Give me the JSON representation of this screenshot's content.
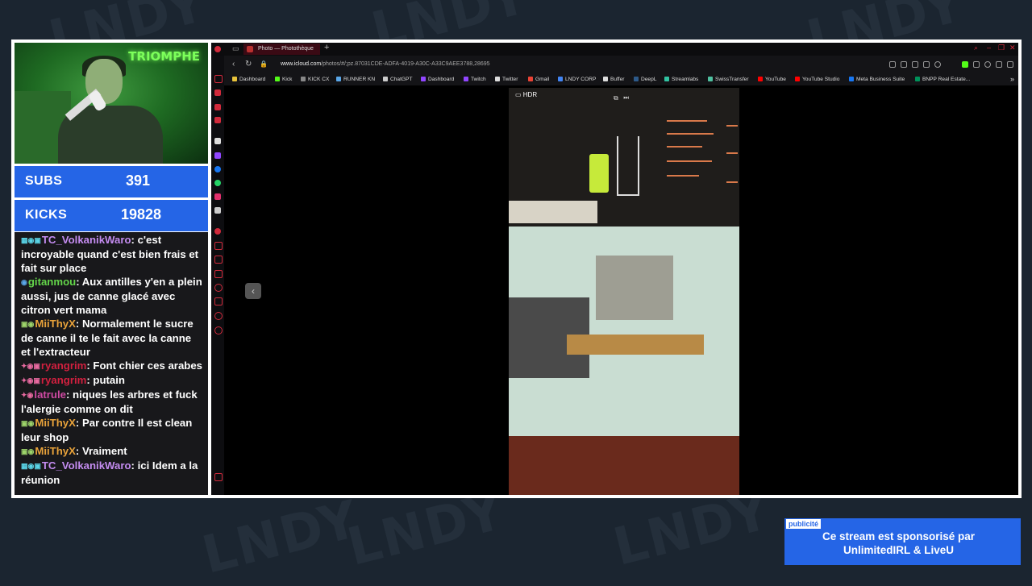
{
  "overlay": {
    "watermark": "LNDY",
    "webcam_sign": "TRIOMPHE",
    "stats": [
      {
        "label": "SUBS",
        "value": "391"
      },
      {
        "label": "KICKS",
        "value": "19828"
      }
    ],
    "ad": {
      "tag": "publicité",
      "line1": "Ce stream est sponsorisé par",
      "line2": "UnlimitedIRL & LiveU"
    }
  },
  "chat": {
    "messages": [
      {
        "badges": "▦◉▣",
        "user": "TC_VolkanikWaro",
        "color": "#c48cf0",
        "text": ": c'est incroyable quand c'est bien frais et fait sur place"
      },
      {
        "badges": "◉",
        "user": "gitanmou",
        "color": "#64d64a",
        "text": ": Aux antilles y'en a plein aussi, jus de canne glacé avec citron vert mama"
      },
      {
        "badges": "▣◉",
        "user": "MiiThyX",
        "color": "#e8a23a",
        "text": ": Normalement le sucre de canne il te le fait avec la canne et l'extracteur"
      },
      {
        "badges": "✦◉▣",
        "user": "ryangrim",
        "color": "#d2203f",
        "text": ": Font chier ces arabes"
      },
      {
        "badges": "✦◉▣",
        "user": "ryangrim",
        "color": "#d2203f",
        "text": ": putain"
      },
      {
        "badges": "✦◉",
        "user": "latrule",
        "color": "#d04aa3",
        "text": ": niques les arbres et fuck l'alergie comme on dit"
      },
      {
        "badges": "▣◉",
        "user": "MiiThyX",
        "color": "#e8a23a",
        "text": ": Par contre Il est clean leur shop"
      },
      {
        "badges": "▣◉",
        "user": "MiiThyX",
        "color": "#e8a23a",
        "text": ": Vraiment"
      },
      {
        "badges": "▦◉▣",
        "user": "TC_VolkanikWaro",
        "color": "#c48cf0",
        "text": ": ici Idem a la réunion"
      }
    ]
  },
  "browser": {
    "tab_title": "Photo — Photothèque",
    "url_prefix": "www.icloud.com",
    "url_rest": "/photos/#/;pz.87031CDE-ADFA-4019-A30C-A33C9AEE3788,28695",
    "bookmarks": [
      {
        "label": "Dashboard",
        "color": "#e8c23a"
      },
      {
        "label": "Kick",
        "color": "#53fc18"
      },
      {
        "label": "KICK CX",
        "color": "#888888"
      },
      {
        "label": "RUNNER KN",
        "color": "#5aa7e8"
      },
      {
        "label": "ChatGPT",
        "color": "#cccccc"
      },
      {
        "label": "Dashboard",
        "color": "#9146ff"
      },
      {
        "label": "Twitch",
        "color": "#9146ff"
      },
      {
        "label": "Twitter",
        "color": "#dddddd"
      },
      {
        "label": "Gmail",
        "color": "#ea4335"
      },
      {
        "label": "LNDY CORP",
        "color": "#4285f4"
      },
      {
        "label": "Buffer",
        "color": "#dddddd"
      },
      {
        "label": "DeepL",
        "color": "#0f2b46"
      },
      {
        "label": "Streamlabs",
        "color": "#31c3a2"
      },
      {
        "label": "SwissTransfer",
        "color": "#4fc0a0"
      },
      {
        "label": "YouTube",
        "color": "#ff0000"
      },
      {
        "label": "YouTube Studio",
        "color": "#ff0000"
      },
      {
        "label": "Meta Business Suite",
        "color": "#1877f2"
      },
      {
        "label": "BNPP Real Estate...",
        "color": "#00915a"
      }
    ],
    "photo_badge": "HDR",
    "prev_glyph": "‹"
  }
}
